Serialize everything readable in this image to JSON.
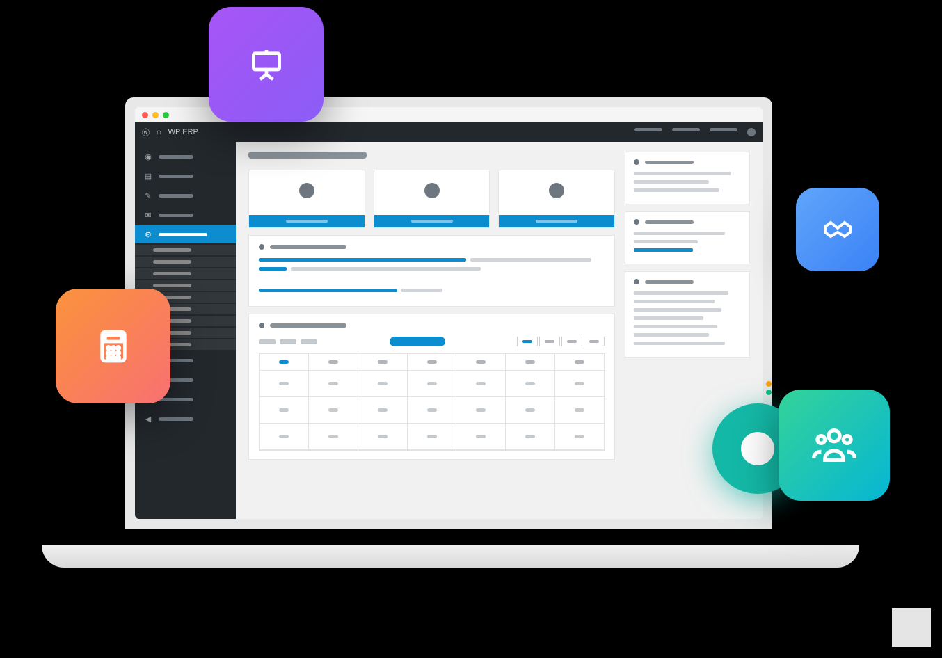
{
  "site_title": "WP ERP",
  "icons": {
    "presentation": "presentation-icon",
    "calculator": "calculator-icon",
    "handshake": "handshake-icon",
    "people": "people-icon"
  },
  "sidebar": {
    "items": [
      {
        "icon": "dashboard"
      },
      {
        "icon": "posts"
      },
      {
        "icon": "media"
      },
      {
        "icon": "comments"
      },
      {
        "icon": "erp",
        "active": true,
        "submenu": [
          "",
          "",
          "",
          "",
          "",
          "",
          "",
          "",
          ""
        ]
      },
      {
        "icon": "analytics"
      },
      {
        "icon": "users"
      },
      {
        "icon": "tools"
      },
      {
        "icon": "settings"
      }
    ]
  },
  "dashboard": {
    "title_placeholder": "",
    "stat_cards": [
      {
        "label": ""
      },
      {
        "label": ""
      },
      {
        "label": ""
      }
    ],
    "progress_panel": {
      "lines": [
        {
          "blue": 0.6,
          "grey": 0.35
        },
        {
          "blue": 0.08,
          "grey": 0.55
        },
        {
          "blue": 0.4,
          "grey": 0.12
        }
      ]
    },
    "calendar": {
      "view_tabs": [
        "",
        "",
        "",
        ""
      ],
      "active_tab": 0,
      "days_header": [
        "",
        "",
        "",
        "",
        "",
        "",
        ""
      ],
      "active_day": 0
    },
    "widgets": [
      {
        "lines": 3
      },
      {
        "lines": 2,
        "has_bar": true
      },
      {
        "lines": 5,
        "has_status": true
      }
    ]
  }
}
